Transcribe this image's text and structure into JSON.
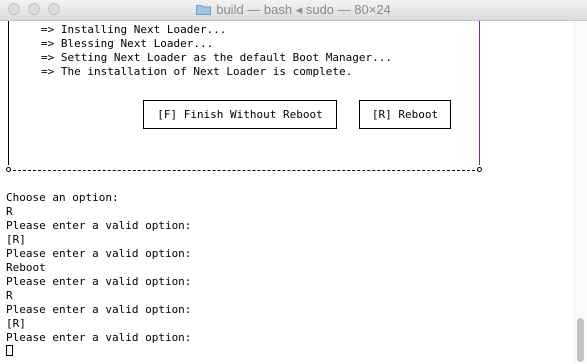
{
  "window": {
    "title": "build — bash ◂ sudo — 80×24"
  },
  "installer": {
    "steps": [
      "=> Installing Next Loader...",
      "=> Blessing Next Loader...",
      "=> Setting Next Loader as the default Boot Manager...",
      "=> The installation of Next Loader is complete."
    ],
    "buttons": {
      "finish": "[F] Finish Without Reboot",
      "reboot": "[R] Reboot"
    }
  },
  "console": {
    "lines": [
      "Choose an option:",
      "R",
      "Please enter a valid option:",
      "[R]",
      "Please enter a valid option:",
      "Reboot",
      "Please enter a valid option:",
      "R",
      "Please enter a valid option:",
      "[R]",
      "Please enter a valid option:"
    ]
  },
  "colors": {
    "frame_left": "#000000",
    "frame_right": "#7a2aa6"
  }
}
